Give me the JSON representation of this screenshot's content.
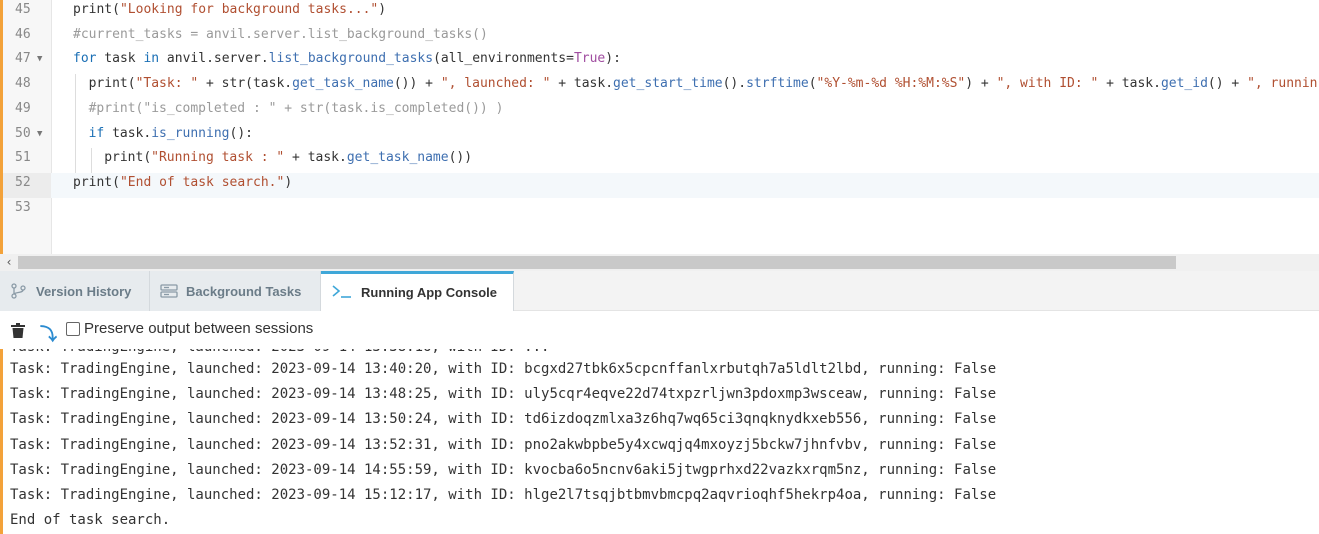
{
  "editor": {
    "lines": [
      {
        "num": "45",
        "indent": 0,
        "fold": false,
        "active": false,
        "tokens": [
          {
            "t": "print(",
            "c": ""
          },
          {
            "t": "\"Looking for background tasks...\"",
            "c": "t-str"
          },
          {
            "t": ")",
            "c": ""
          }
        ]
      },
      {
        "num": "46",
        "indent": 0,
        "fold": false,
        "active": false,
        "tokens": [
          {
            "t": "#current_tasks = anvil.server.list_background_tasks()",
            "c": "t-com"
          }
        ]
      },
      {
        "num": "47",
        "indent": 0,
        "fold": true,
        "active": false,
        "tokens": [
          {
            "t": "for",
            "c": "t-kw"
          },
          {
            "t": " task ",
            "c": ""
          },
          {
            "t": "in",
            "c": "t-kw"
          },
          {
            "t": " anvil.server.",
            "c": ""
          },
          {
            "t": "list_background_tasks",
            "c": "t-fn"
          },
          {
            "t": "(all_environments=",
            "c": ""
          },
          {
            "t": "True",
            "c": "t-bool"
          },
          {
            "t": "):",
            "c": ""
          }
        ]
      },
      {
        "num": "48",
        "indent": 1,
        "fold": false,
        "active": false,
        "tokens": [
          {
            "t": "print(",
            "c": ""
          },
          {
            "t": "\"Task: \"",
            "c": "t-str"
          },
          {
            "t": " + str(task.",
            "c": ""
          },
          {
            "t": "get_task_name",
            "c": "t-fn"
          },
          {
            "t": "()) + ",
            "c": ""
          },
          {
            "t": "\", launched: \"",
            "c": "t-str"
          },
          {
            "t": " + task.",
            "c": ""
          },
          {
            "t": "get_start_time",
            "c": "t-fn"
          },
          {
            "t": "().",
            "c": ""
          },
          {
            "t": "strftime",
            "c": "t-fn"
          },
          {
            "t": "(",
            "c": ""
          },
          {
            "t": "\"%Y-%m-%d %H:%M:%S\"",
            "c": "t-str"
          },
          {
            "t": ") + ",
            "c": ""
          },
          {
            "t": "\", with ID: \"",
            "c": "t-str"
          },
          {
            "t": " + task.",
            "c": ""
          },
          {
            "t": "get_id",
            "c": "t-fn"
          },
          {
            "t": "() + ",
            "c": ""
          },
          {
            "t": "\", runnin",
            "c": "t-str"
          }
        ]
      },
      {
        "num": "49",
        "indent": 1,
        "fold": false,
        "active": false,
        "tokens": [
          {
            "t": "#print(\"is_completed : \" + str(task.is_completed()) )",
            "c": "t-com"
          }
        ]
      },
      {
        "num": "50",
        "indent": 1,
        "fold": true,
        "active": false,
        "tokens": [
          {
            "t": "if",
            "c": "t-kw"
          },
          {
            "t": " task.",
            "c": ""
          },
          {
            "t": "is_running",
            "c": "t-fn"
          },
          {
            "t": "():",
            "c": ""
          }
        ]
      },
      {
        "num": "51",
        "indent": 2,
        "fold": false,
        "active": false,
        "tokens": [
          {
            "t": "print(",
            "c": ""
          },
          {
            "t": "\"Running task : \"",
            "c": "t-str"
          },
          {
            "t": " + task.",
            "c": ""
          },
          {
            "t": "get_task_name",
            "c": "t-fn"
          },
          {
            "t": "())",
            "c": ""
          }
        ]
      },
      {
        "num": "52",
        "indent": 0,
        "fold": false,
        "active": true,
        "tokens": [
          {
            "t": "print(",
            "c": ""
          },
          {
            "t": "\"End of task search.\"",
            "c": "t-str"
          },
          {
            "t": ")",
            "c": ""
          }
        ]
      },
      {
        "num": "53",
        "indent": 0,
        "fold": false,
        "active": false,
        "tokens": []
      }
    ],
    "scroll_left_arrow": "‹"
  },
  "tabs": [
    {
      "label": "Version History",
      "icon": "branch-icon",
      "active": false
    },
    {
      "label": "Background Tasks",
      "icon": "list-icon",
      "active": false
    },
    {
      "label": "Running App Console",
      "icon": "terminal-icon",
      "active": true
    }
  ],
  "toolbar": {
    "clear_icon": "trash-icon",
    "jump_icon": "jump-to-bottom-icon",
    "jump_glyph": "⤵",
    "preserve_label": "Preserve output between sessions",
    "preserve_checked": false
  },
  "console": {
    "lines": [
      "Task: TradingEngine, launched: 2023-09-14 13:40:20, with ID: bcgxd27tbk6x5cpcnffanlxrbutqh7a5ldlt2lbd, running: False",
      "Task: TradingEngine, launched: 2023-09-14 13:48:25, with ID: uly5cqr4eqve22d74txpzrljwn3pdoxmp3wsceaw, running: False",
      "Task: TradingEngine, launched: 2023-09-14 13:50:24, with ID: td6izdoqzmlxa3z6hq7wq65ci3qnqknydkxeb556, running: False",
      "Task: TradingEngine, launched: 2023-09-14 13:52:31, with ID: pno2akwbpbe5y4xcwqjq4mxoyzj5bckw7jhnfvbv, running: False",
      "Task: TradingEngine, launched: 2023-09-14 14:55:59, with ID: kvocba6o5ncnv6aki5jtwgprhxd22vazkxrqm5nz, running: False",
      "Task: TradingEngine, launched: 2023-09-14 15:12:17, with ID: hlge2l7tsqjbtbmvbmcpq2aqvrioqhf5hekrp4oa, running: False",
      "End of task search."
    ]
  },
  "colors": {
    "accent": "#3fa7d8",
    "edge": "#f3a23a",
    "string": "#b04f31",
    "keyword": "#1a6fb5"
  }
}
